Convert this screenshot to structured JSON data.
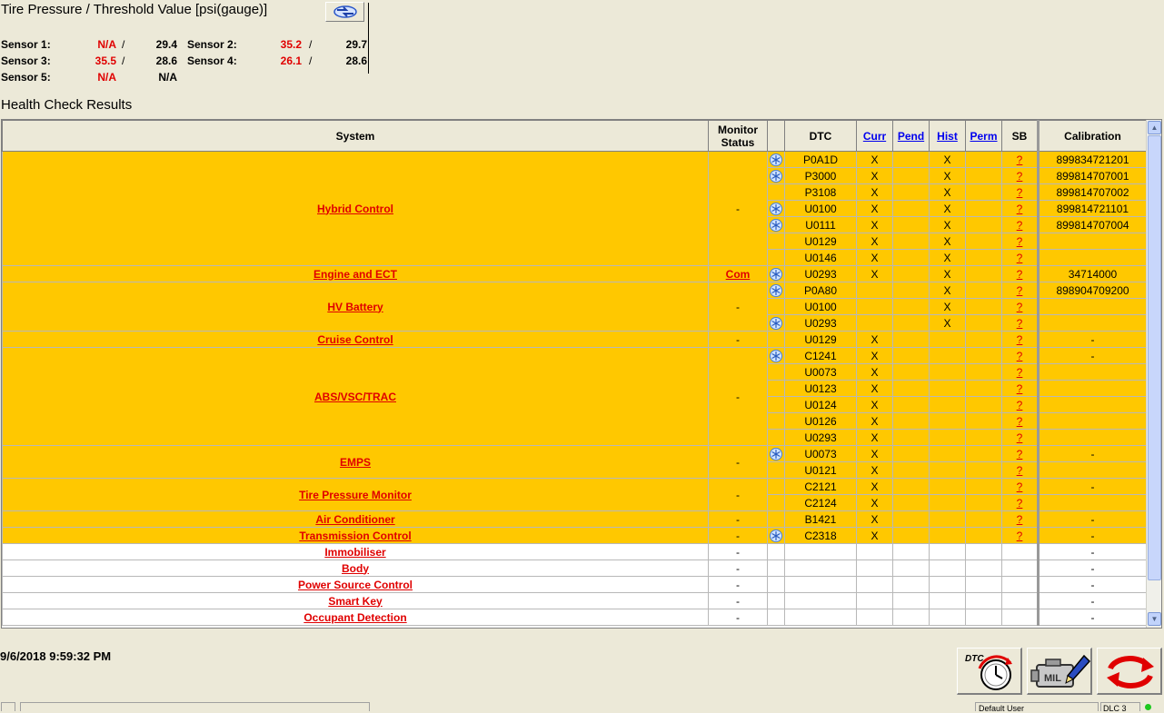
{
  "tpms": {
    "title": "Tire Pressure / Threshold Value [psi(gauge)]",
    "sensors": [
      {
        "label": "Sensor 1:",
        "value": "N/A",
        "threshold": "29.4"
      },
      {
        "label": "Sensor 2:",
        "value": "35.2",
        "threshold": "29.7"
      },
      {
        "label": "Sensor 3:",
        "value": "35.5",
        "threshold": "28.6"
      },
      {
        "label": "Sensor 4:",
        "value": "26.1",
        "threshold": "28.6"
      },
      {
        "label": "Sensor 5:",
        "value": "N/A",
        "threshold": "N/A"
      }
    ],
    "separator": "/"
  },
  "health": {
    "title": "Health Check Results",
    "headers": {
      "system": "System",
      "monitor": "Monitor Status",
      "dtc": "DTC",
      "curr": "Curr",
      "pend": "Pend",
      "hist": "Hist",
      "perm": "Perm",
      "sb": "SB",
      "calibration": "Calibration"
    },
    "systems": [
      {
        "name": "Hybrid Control",
        "monitor": "-",
        "highlight": true,
        "calibration": "",
        "dtcs": [
          {
            "code": "P0A1D",
            "freeze": true,
            "curr": "X",
            "pend": "",
            "hist": "X",
            "perm": "",
            "sb": "?",
            "cal": "899834721201"
          },
          {
            "code": "P3000",
            "freeze": true,
            "curr": "X",
            "pend": "",
            "hist": "X",
            "perm": "",
            "sb": "?",
            "cal": "899814707001"
          },
          {
            "code": "P3108",
            "freeze": false,
            "curr": "X",
            "pend": "",
            "hist": "X",
            "perm": "",
            "sb": "?",
            "cal": "899814707002"
          },
          {
            "code": "U0100",
            "freeze": true,
            "curr": "X",
            "pend": "",
            "hist": "X",
            "perm": "",
            "sb": "?",
            "cal": "899814721101"
          },
          {
            "code": "U0111",
            "freeze": true,
            "curr": "X",
            "pend": "",
            "hist": "X",
            "perm": "",
            "sb": "?",
            "cal": "899814707004"
          },
          {
            "code": "U0129",
            "freeze": false,
            "curr": "X",
            "pend": "",
            "hist": "X",
            "perm": "",
            "sb": "?",
            "cal": ""
          },
          {
            "code": "U0146",
            "freeze": false,
            "curr": "X",
            "pend": "",
            "hist": "X",
            "perm": "",
            "sb": "?",
            "cal": ""
          }
        ]
      },
      {
        "name": "Engine and ECT",
        "monitor": "Com",
        "highlight": true,
        "dtcs": [
          {
            "code": "U0293",
            "freeze": true,
            "curr": "X",
            "pend": "",
            "hist": "X",
            "perm": "",
            "sb": "?",
            "cal": "34714000"
          }
        ]
      },
      {
        "name": "HV Battery",
        "monitor": "-",
        "highlight": true,
        "dtcs": [
          {
            "code": "P0A80",
            "freeze": true,
            "curr": "",
            "pend": "",
            "hist": "X",
            "perm": "",
            "sb": "?",
            "cal": "898904709200"
          },
          {
            "code": "U0100",
            "freeze": false,
            "curr": "",
            "pend": "",
            "hist": "X",
            "perm": "",
            "sb": "?",
            "cal": ""
          },
          {
            "code": "U0293",
            "freeze": true,
            "curr": "",
            "pend": "",
            "hist": "X",
            "perm": "",
            "sb": "?",
            "cal": ""
          }
        ]
      },
      {
        "name": "Cruise Control",
        "monitor": "-",
        "highlight": true,
        "dtcs": [
          {
            "code": "U0129",
            "freeze": false,
            "curr": "X",
            "pend": "",
            "hist": "",
            "perm": "",
            "sb": "?",
            "cal": "-"
          }
        ]
      },
      {
        "name": "ABS/VSC/TRAC",
        "monitor": "-",
        "highlight": true,
        "dtcs": [
          {
            "code": "C1241",
            "freeze": true,
            "curr": "X",
            "pend": "",
            "hist": "",
            "perm": "",
            "sb": "?",
            "cal": "-"
          },
          {
            "code": "U0073",
            "freeze": false,
            "curr": "X",
            "pend": "",
            "hist": "",
            "perm": "",
            "sb": "?",
            "cal": ""
          },
          {
            "code": "U0123",
            "freeze": false,
            "curr": "X",
            "pend": "",
            "hist": "",
            "perm": "",
            "sb": "?",
            "cal": ""
          },
          {
            "code": "U0124",
            "freeze": false,
            "curr": "X",
            "pend": "",
            "hist": "",
            "perm": "",
            "sb": "?",
            "cal": ""
          },
          {
            "code": "U0126",
            "freeze": false,
            "curr": "X",
            "pend": "",
            "hist": "",
            "perm": "",
            "sb": "?",
            "cal": ""
          },
          {
            "code": "U0293",
            "freeze": false,
            "curr": "X",
            "pend": "",
            "hist": "",
            "perm": "",
            "sb": "?",
            "cal": ""
          }
        ]
      },
      {
        "name": "EMPS",
        "monitor": "-",
        "highlight": true,
        "dtcs": [
          {
            "code": "U0073",
            "freeze": true,
            "curr": "X",
            "pend": "",
            "hist": "",
            "perm": "",
            "sb": "?",
            "cal": "-"
          },
          {
            "code": "U0121",
            "freeze": false,
            "curr": "X",
            "pend": "",
            "hist": "",
            "perm": "",
            "sb": "?",
            "cal": ""
          }
        ]
      },
      {
        "name": "Tire Pressure Monitor",
        "monitor": "-",
        "highlight": true,
        "dtcs": [
          {
            "code": "C2121",
            "freeze": false,
            "curr": "X",
            "pend": "",
            "hist": "",
            "perm": "",
            "sb": "?",
            "cal": "-"
          },
          {
            "code": "C2124",
            "freeze": false,
            "curr": "X",
            "pend": "",
            "hist": "",
            "perm": "",
            "sb": "?",
            "cal": ""
          }
        ]
      },
      {
        "name": "Air Conditioner",
        "monitor": "-",
        "highlight": true,
        "dtcs": [
          {
            "code": "B1421",
            "freeze": false,
            "curr": "X",
            "pend": "",
            "hist": "",
            "perm": "",
            "sb": "?",
            "cal": "-"
          }
        ]
      },
      {
        "name": "Transmission Control",
        "monitor": "-",
        "highlight": true,
        "dtcs": [
          {
            "code": "C2318",
            "freeze": true,
            "curr": "X",
            "pend": "",
            "hist": "",
            "perm": "",
            "sb": "?",
            "cal": "-"
          }
        ]
      },
      {
        "name": "Immobiliser",
        "monitor": "-",
        "highlight": false,
        "dtcs": [
          {
            "code": "",
            "freeze": false,
            "curr": "",
            "pend": "",
            "hist": "",
            "perm": "",
            "sb": "",
            "cal": "-"
          }
        ]
      },
      {
        "name": "Body",
        "monitor": "-",
        "highlight": false,
        "dtcs": [
          {
            "code": "",
            "freeze": false,
            "curr": "",
            "pend": "",
            "hist": "",
            "perm": "",
            "sb": "",
            "cal": "-"
          }
        ]
      },
      {
        "name": "Power Source Control",
        "monitor": "-",
        "highlight": false,
        "dtcs": [
          {
            "code": "",
            "freeze": false,
            "curr": "",
            "pend": "",
            "hist": "",
            "perm": "",
            "sb": "",
            "cal": "-"
          }
        ]
      },
      {
        "name": "Smart Key",
        "monitor": "-",
        "highlight": false,
        "dtcs": [
          {
            "code": "",
            "freeze": false,
            "curr": "",
            "pend": "",
            "hist": "",
            "perm": "",
            "sb": "",
            "cal": "-"
          }
        ]
      },
      {
        "name": "Occupant Detection",
        "monitor": "-",
        "highlight": false,
        "dtcs": [
          {
            "code": "",
            "freeze": false,
            "curr": "",
            "pend": "",
            "hist": "",
            "perm": "",
            "sb": "",
            "cal": "-"
          }
        ]
      }
    ]
  },
  "timestamp": "9/6/2018 9:59:32 PM",
  "toolbar": {
    "dtc_label": "DTC",
    "mil_label": "MIL"
  },
  "status_bar": {
    "user": "Default User",
    "connection": "DLC 3"
  },
  "colors": {
    "highlight": "#ffc800",
    "alert_red": "#e00000",
    "link_blue": "#0000ee",
    "connected_green": "#1ec81e"
  },
  "icons": {
    "freeze_frame": "snowflake-icon",
    "refresh": "refresh-arrows-icon",
    "dtc_clock": "dtc-clock-icon",
    "mil_engine": "check-engine-icon"
  }
}
